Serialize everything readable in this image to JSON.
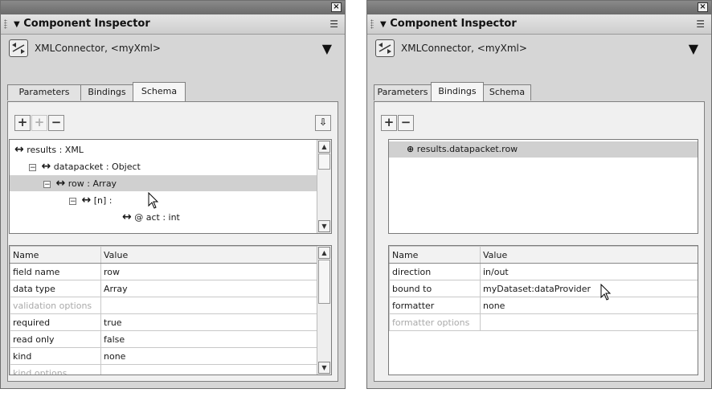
{
  "left_panel": {
    "title": "Component Inspector",
    "component": "XMLConnector, <myXml>",
    "tabs": [
      "Parameters",
      "Bindings",
      "Schema"
    ],
    "active_tab": "Schema",
    "toolbar": {
      "add_icon": "add-icon",
      "add_child_icon": "add-child-icon",
      "remove_icon": "remove-icon",
      "import_icon": "import-schema-icon"
    },
    "tree": [
      {
        "label": "results : XML"
      },
      {
        "label": "datapacket : Object"
      },
      {
        "label": "row : Array"
      },
      {
        "label": "[n] :"
      },
      {
        "label": "@ act : int"
      }
    ],
    "grid": {
      "headers": [
        "Name",
        "Value"
      ],
      "rows": [
        {
          "name": "field name",
          "value": "row"
        },
        {
          "name": "data type",
          "value": "Array"
        },
        {
          "name": "validation options",
          "value": ""
        },
        {
          "name": "required",
          "value": "true"
        },
        {
          "name": "read only",
          "value": "false"
        },
        {
          "name": "kind",
          "value": "none"
        },
        {
          "name": "kind options",
          "value": ""
        }
      ]
    }
  },
  "right_panel": {
    "title": "Component Inspector",
    "component": "XMLConnector, <myXml>",
    "tabs": [
      "Parameters",
      "Bindings",
      "Schema"
    ],
    "active_tab": "Bindings",
    "bindings": [
      "results.datapacket.row"
    ],
    "grid": {
      "headers": [
        "Name",
        "Value"
      ],
      "rows": [
        {
          "name": "direction",
          "value": "in/out"
        },
        {
          "name": "bound to",
          "value": "myDataset:dataProvider"
        },
        {
          "name": "formatter",
          "value": "none"
        },
        {
          "name": "formatter options",
          "value": ""
        }
      ]
    }
  },
  "glyphs": {
    "close": "×",
    "menu": "☰",
    "dropdown": "▼",
    "collapse": "−",
    "arrow": "↔",
    "binding": "⊕"
  }
}
